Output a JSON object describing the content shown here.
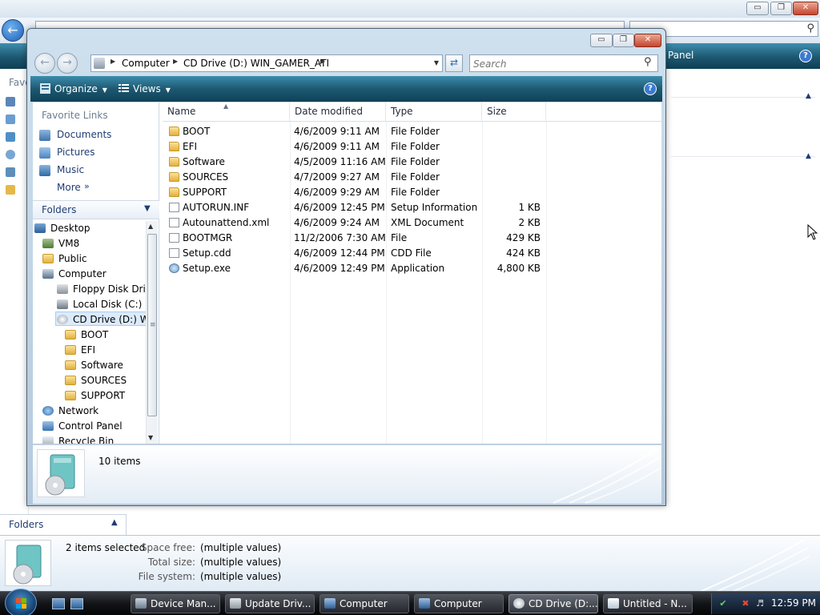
{
  "background_window": {
    "toolbar_label": "Panel",
    "favorites_label": "Favo",
    "folders_label": "Folders",
    "details": {
      "items_selected": "2 items selected",
      "space_free_label": "Space free:",
      "space_free_value": "(multiple values)",
      "total_size_label": "Total size:",
      "total_size_value": "(multiple values)",
      "file_system_label": "File system:",
      "file_system_value": "(multiple values)"
    }
  },
  "window": {
    "minimize": "▭",
    "maximize": "❐",
    "close": "✕",
    "breadcrumb": [
      "Computer",
      "CD Drive (D:) WIN_GAMER_ATI"
    ],
    "search_placeholder": "Search",
    "toolbar": {
      "organize": "Organize",
      "views": "Views",
      "help": "?"
    },
    "nav": {
      "favorite_links_heading": "Favorite Links",
      "favorite_links": [
        "Documents",
        "Pictures",
        "Music"
      ],
      "more": "More",
      "folders_label": "Folders",
      "tree": [
        {
          "label": "Desktop",
          "level": 0
        },
        {
          "label": "VM8",
          "level": 1
        },
        {
          "label": "Public",
          "level": 1
        },
        {
          "label": "Computer",
          "level": 1
        },
        {
          "label": "Floppy Disk Drive (",
          "level": 2
        },
        {
          "label": "Local Disk (C:)",
          "level": 2
        },
        {
          "label": "CD Drive (D:) WIN_",
          "level": 2,
          "selected": true
        },
        {
          "label": "BOOT",
          "level": 3
        },
        {
          "label": "EFI",
          "level": 3
        },
        {
          "label": "Software",
          "level": 3
        },
        {
          "label": "SOURCES",
          "level": 3
        },
        {
          "label": "SUPPORT",
          "level": 3
        },
        {
          "label": "Network",
          "level": 1
        },
        {
          "label": "Control Panel",
          "level": 1
        },
        {
          "label": "Recycle Bin",
          "level": 1
        }
      ]
    },
    "columns": {
      "name": "Name",
      "date_modified": "Date modified",
      "type": "Type",
      "size": "Size"
    },
    "files": [
      {
        "name": "BOOT",
        "date": "4/6/2009 9:11 AM",
        "type": "File Folder",
        "size": "",
        "icon": "folder-icon"
      },
      {
        "name": "EFI",
        "date": "4/6/2009 9:11 AM",
        "type": "File Folder",
        "size": "",
        "icon": "folder-icon"
      },
      {
        "name": "Software",
        "date": "4/5/2009 11:16 AM",
        "type": "File Folder",
        "size": "",
        "icon": "folder-icon"
      },
      {
        "name": "SOURCES",
        "date": "4/7/2009 9:27 AM",
        "type": "File Folder",
        "size": "",
        "icon": "folder-icon"
      },
      {
        "name": "SUPPORT",
        "date": "4/6/2009 9:29 AM",
        "type": "File Folder",
        "size": "",
        "icon": "folder-icon"
      },
      {
        "name": "AUTORUN.INF",
        "date": "4/6/2009 12:45 PM",
        "type": "Setup Information",
        "size": "1 KB",
        "icon": "settings-file-icon"
      },
      {
        "name": "Autounattend.xml",
        "date": "4/6/2009 9:24 AM",
        "type": "XML Document",
        "size": "2 KB",
        "icon": "document-icon"
      },
      {
        "name": "BOOTMGR",
        "date": "11/2/2006 7:30 AM",
        "type": "File",
        "size": "429 KB",
        "icon": "document-icon"
      },
      {
        "name": "Setup.cdd",
        "date": "4/6/2009 12:44 PM",
        "type": "CDD File",
        "size": "424 KB",
        "icon": "document-icon"
      },
      {
        "name": "Setup.exe",
        "date": "4/6/2009 12:49 PM",
        "type": "Application",
        "size": "4,800 KB",
        "icon": "setup-app-icon"
      }
    ],
    "details_text": "10 items"
  },
  "taskbar": {
    "buttons": [
      {
        "label": "Device Man..."
      },
      {
        "label": "Update Driv..."
      },
      {
        "label": "Computer"
      },
      {
        "label": "Computer"
      },
      {
        "label": "CD Drive (D:..."
      },
      {
        "label": "Untitled - N..."
      }
    ],
    "clock": "12:59 PM"
  }
}
